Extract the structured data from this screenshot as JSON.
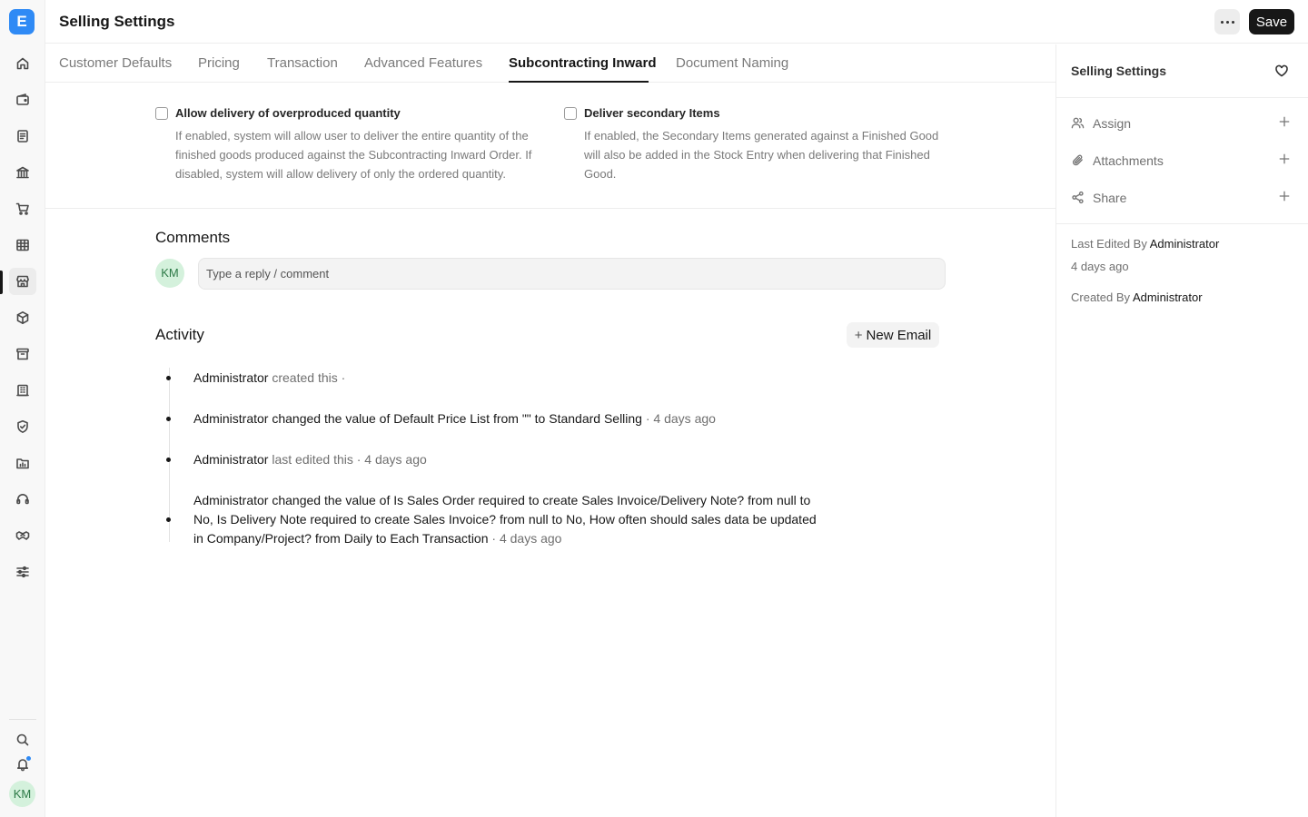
{
  "app": {
    "logo_letter": "E"
  },
  "header": {
    "title": "Selling Settings",
    "save_label": "Save"
  },
  "tabs": [
    {
      "label": "Customer Defaults"
    },
    {
      "label": "Pricing"
    },
    {
      "label": "Transaction"
    },
    {
      "label": "Advanced Features"
    },
    {
      "label": "Subcontracting Inward",
      "active": true
    },
    {
      "label": "Document Naming"
    }
  ],
  "fields": [
    {
      "label": "Allow delivery of overproduced quantity",
      "description": "If enabled, system will allow user to deliver the entire quantity of the finished goods produced against the Subcontracting Inward Order. If disabled, system will allow delivery of only the ordered quantity.",
      "checked": false
    },
    {
      "label": "Deliver secondary Items",
      "description": "If enabled, the Secondary Items generated against a Finished Good will also be added in the Stock Entry when delivering that Finished Good.",
      "checked": false
    }
  ],
  "comments": {
    "title": "Comments",
    "avatar_initials": "KM",
    "placeholder": "Type a reply / comment"
  },
  "activity": {
    "title": "Activity",
    "new_email_label": "New Email",
    "items": [
      {
        "parts": [
          {
            "text": "Administrator",
            "style": "strong"
          },
          {
            "text": " created this · ",
            "style": "muted"
          }
        ]
      },
      {
        "parts": [
          {
            "text": "Administrator changed the value of Default Price List from \"\" to ",
            "style": "normal"
          },
          {
            "text": "Standard Selling",
            "style": "strong"
          },
          {
            "text": " · 4 days ago",
            "style": "muted"
          }
        ]
      },
      {
        "parts": [
          {
            "text": "Administrator",
            "style": "strong"
          },
          {
            "text": " last edited this · 4 days ago",
            "style": "muted"
          }
        ]
      },
      {
        "parts": [
          {
            "text": "Administrator changed the value of Is Sales Order required to create Sales Invoice/Delivery Note? from ",
            "style": "normal"
          },
          {
            "text": "null",
            "style": "strong"
          },
          {
            "text": " to ",
            "style": "normal"
          },
          {
            "text": "No",
            "style": "strong"
          },
          {
            "text": ", Is Delivery Note required to create Sales Invoice? from ",
            "style": "normal"
          },
          {
            "text": "null",
            "style": "strong"
          },
          {
            "text": " to ",
            "style": "normal"
          },
          {
            "text": "No",
            "style": "strong"
          },
          {
            "text": ", How often should sales data be updated in Company/Project? from ",
            "style": "normal"
          },
          {
            "text": "Daily",
            "style": "strong"
          },
          {
            "text": " to ",
            "style": "normal"
          },
          {
            "text": "Each Transaction",
            "style": "strong"
          },
          {
            "text": " · 4 days ago",
            "style": "muted"
          }
        ]
      }
    ]
  },
  "sidebar": {
    "title": "Selling Settings",
    "assign_label": "Assign",
    "attachments_label": "Attachments",
    "share_label": "Share",
    "last_edited_prefix": "Last Edited By",
    "last_edited_by": "Administrator",
    "last_edited_time": "4 days ago",
    "created_prefix": "Created By",
    "created_by": "Administrator"
  },
  "rail": {
    "items": [
      "home-icon",
      "wallet-icon",
      "document-icon",
      "bank-icon",
      "cart-icon",
      "table-icon",
      "store-icon",
      "package-icon",
      "archive-icon",
      "building-icon",
      "shield-icon",
      "folder-chart-icon",
      "headset-icon",
      "handshake-icon",
      "sliders-icon"
    ],
    "active": "store-icon",
    "user_initials": "KM"
  },
  "colors": {
    "accent": "#2f8af5",
    "primary_button": "#171717",
    "avatar_bg": "#d4f1dc"
  }
}
